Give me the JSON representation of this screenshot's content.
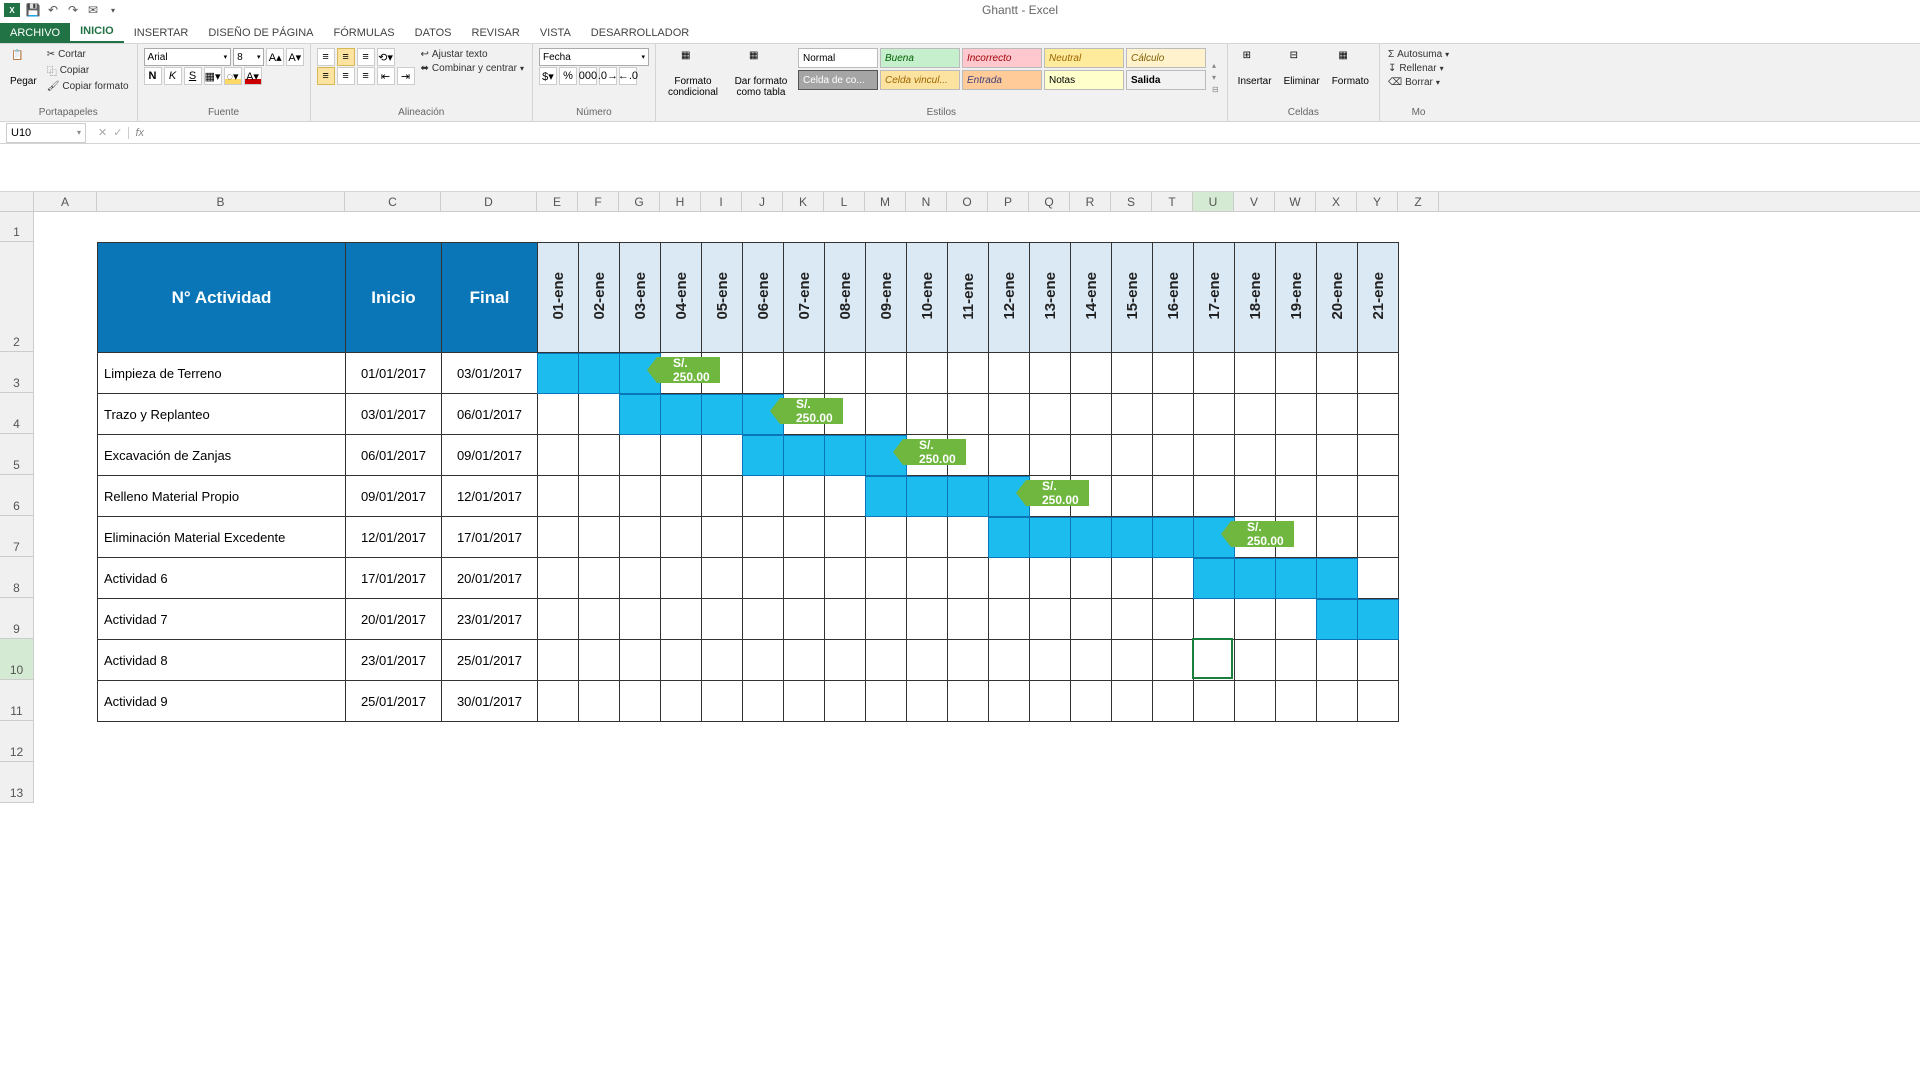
{
  "app": {
    "title": "Ghantt - Excel"
  },
  "qat": [
    "excel-icon",
    "save-icon",
    "undo-icon",
    "redo-icon",
    "mail-icon"
  ],
  "tabs": {
    "file": "ARCHIVO",
    "items": [
      "INICIO",
      "INSERTAR",
      "DISEÑO DE PÁGINA",
      "FÓRMULAS",
      "DATOS",
      "REVISAR",
      "VISTA",
      "DESARROLLADOR"
    ],
    "active": 0
  },
  "ribbon": {
    "clipboard": {
      "paste": "Pegar",
      "cut": "Cortar",
      "copy": "Copiar",
      "fmtpainter": "Copiar formato",
      "label": "Portapapeles"
    },
    "font": {
      "name": "Arial",
      "size": "8",
      "label": "Fuente",
      "bold": "N",
      "italic": "K",
      "underline": "S"
    },
    "alignment": {
      "wrap": "Ajustar texto",
      "merge": "Combinar y centrar",
      "label": "Alineación"
    },
    "number": {
      "format": "Fecha",
      "label": "Número"
    },
    "styles": {
      "condfmt": "Formato condicional",
      "astable": "Dar formato como tabla",
      "cells": [
        "Normal",
        "Buena",
        "Incorrecto",
        "Neutral",
        "Cálculo",
        "Celda de co...",
        "Celda vincul...",
        "Entrada",
        "Notas",
        "Salida"
      ],
      "label": "Estilos"
    },
    "cells2": {
      "insert": "Insertar",
      "delete": "Eliminar",
      "format": "Formato",
      "label": "Celdas"
    },
    "editing": {
      "autosum": "Autosuma",
      "fill": "Rellenar",
      "clear": "Borrar",
      "label": "Mo"
    }
  },
  "formula": {
    "namebox": "U10",
    "fx": "fx"
  },
  "columns": [
    "A",
    "B",
    "C",
    "D",
    "E",
    "F",
    "G",
    "H",
    "I",
    "J",
    "K",
    "L",
    "M",
    "N",
    "O",
    "P",
    "Q",
    "R",
    "S",
    "T",
    "U",
    "V",
    "W",
    "X",
    "Y",
    "Z"
  ],
  "rows": [
    "1",
    "2",
    "3",
    "4",
    "5",
    "6",
    "7",
    "8",
    "9",
    "10",
    "11",
    "12",
    "13"
  ],
  "selected": {
    "col": "U",
    "row": "10"
  },
  "chart_data": {
    "type": "table",
    "headers": {
      "activity": "N° Actividad",
      "start": "Inicio",
      "end": "Final"
    },
    "dates": [
      "01-ene",
      "02-ene",
      "03-ene",
      "04-ene",
      "05-ene",
      "06-ene",
      "07-ene",
      "08-ene",
      "09-ene",
      "10-ene",
      "11-ene",
      "12-ene",
      "13-ene",
      "14-ene",
      "15-ene",
      "16-ene",
      "17-ene",
      "18-ene",
      "19-ene",
      "20-ene",
      "21-ene"
    ],
    "rows": [
      {
        "activity": "Limpieza de Terreno",
        "start": "01/01/2017",
        "end": "03/01/2017",
        "barFrom": 1,
        "barTo": 3,
        "cost": "S/. 250.00",
        "costAt": 4
      },
      {
        "activity": "Trazo y Replanteo",
        "start": "03/01/2017",
        "end": "06/01/2017",
        "barFrom": 3,
        "barTo": 6,
        "cost": "S/. 250.00",
        "costAt": 7
      },
      {
        "activity": "Excavación de Zanjas",
        "start": "06/01/2017",
        "end": "09/01/2017",
        "barFrom": 6,
        "barTo": 9,
        "cost": "S/. 250.00",
        "costAt": 10
      },
      {
        "activity": "Relleno Material Propio",
        "start": "09/01/2017",
        "end": "12/01/2017",
        "barFrom": 9,
        "barTo": 12,
        "cost": "S/. 250.00",
        "costAt": 13
      },
      {
        "activity": "Eliminación Material Excedente",
        "start": "12/01/2017",
        "end": "17/01/2017",
        "barFrom": 12,
        "barTo": 17,
        "cost": "S/. 250.00",
        "costAt": 18
      },
      {
        "activity": "Actividad 6",
        "start": "17/01/2017",
        "end": "20/01/2017",
        "barFrom": 17,
        "barTo": 20
      },
      {
        "activity": "Actividad 7",
        "start": "20/01/2017",
        "end": "23/01/2017",
        "barFrom": 20,
        "barTo": 21
      },
      {
        "activity": "Actividad 8",
        "start": "23/01/2017",
        "end": "25/01/2017"
      },
      {
        "activity": "Actividad 9",
        "start": "25/01/2017",
        "end": "30/01/2017"
      }
    ]
  }
}
